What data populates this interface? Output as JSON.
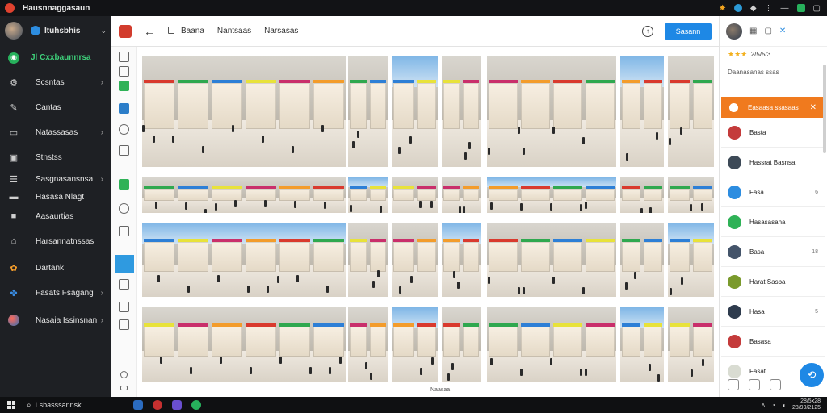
{
  "window": {
    "title": "Hausnnaggasaun"
  },
  "sidebar": {
    "workspace": "Ituhsbhis",
    "active_item": "Jl Cxxbaunnrsa",
    "items": [
      {
        "label": "Scsntas",
        "icon": "sliders-icon",
        "arrow": true
      },
      {
        "label": "Cantas",
        "icon": "pin-icon",
        "arrow": false
      },
      {
        "label": "Natassasas",
        "icon": "folder-icon",
        "arrow": true
      },
      {
        "label": "Stnstss",
        "icon": "chart-icon",
        "arrow": false
      },
      {
        "label": "Sasgnasansnsa",
        "icon": "layers-icon",
        "arrow": true
      },
      {
        "label": "Hasasa Nlagt",
        "icon": "card-icon",
        "arrow": false
      },
      {
        "label": "Aasaurtias",
        "icon": "square-icon",
        "arrow": false
      },
      {
        "label": "Harsannatnssas",
        "icon": "house-icon",
        "arrow": false
      },
      {
        "label": "Dartank",
        "icon": "flower-icon",
        "arrow": false
      },
      {
        "label": "Fasats Fsagang",
        "icon": "puzzle-icon",
        "arrow": true
      },
      {
        "label": "Nasaia Issinsnan",
        "icon": "globe-icon",
        "arrow": true
      }
    ]
  },
  "toolbar": {
    "tabs": [
      "Baana",
      "Nantsaas",
      "Narsasas"
    ],
    "primary_button": "Sasann"
  },
  "grid": {
    "footer": "Naasaa"
  },
  "right_panel": {
    "rating": "★★★",
    "rating_text": "2/5/5/3",
    "subtitle": "Daanasanas ssas",
    "active": {
      "label": "Easaasa ssasaas"
    },
    "rows": [
      {
        "name": "Basta",
        "meta": "",
        "color": "#c43b3b"
      },
      {
        "name": "Hassrat Basnsa",
        "meta": "",
        "color": "#3d4a57"
      },
      {
        "name": "Fasa",
        "meta": "6",
        "color": "#2d8de0"
      },
      {
        "name": "Hasasasana",
        "meta": "",
        "color": "#2fb257"
      },
      {
        "name": "Basa",
        "meta": "18",
        "color": "#44546a"
      },
      {
        "name": "Harat Sasba",
        "meta": "",
        "color": "#7a9a2c"
      },
      {
        "name": "Hasa",
        "meta": "5",
        "color": "#2e3b4d"
      },
      {
        "name": "Basasa",
        "meta": "",
        "color": "#c43b3b"
      },
      {
        "name": "Fasat",
        "meta": "",
        "color": "#d9dcd2"
      }
    ]
  },
  "taskbar": {
    "search": "Lsbasssannsk",
    "tray_time": "28/5x28",
    "tray_date": "28/99/2125"
  }
}
